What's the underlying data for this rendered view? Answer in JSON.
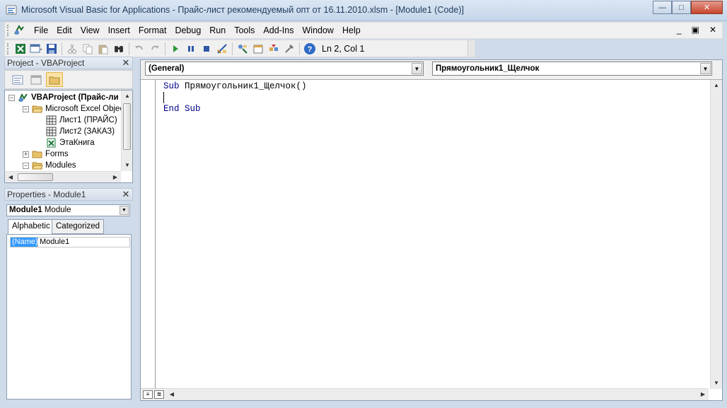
{
  "window": {
    "title": "Microsoft Visual Basic for Applications - Прайс-лист рекомендуемый опт от 16.11.2010.xlsm - [Module1 (Code)]",
    "buttons": {
      "minimize": "—",
      "restore": "□",
      "close": "✕"
    }
  },
  "menu": {
    "items": [
      "File",
      "Edit",
      "View",
      "Insert",
      "Format",
      "Debug",
      "Run",
      "Tools",
      "Add-Ins",
      "Window",
      "Help"
    ],
    "mdi": {
      "minimize": "_",
      "restore": "▣",
      "close": "✕"
    }
  },
  "toolbar": {
    "status": "Ln 2, Col 1",
    "icons": [
      "view-excel-icon",
      "insert-userform-icon",
      "save-icon",
      "cut-icon",
      "copy-icon",
      "paste-icon",
      "find-icon",
      "undo-icon",
      "redo-icon",
      "run-icon",
      "break-icon",
      "reset-icon",
      "design-mode-icon",
      "project-explorer-icon",
      "properties-window-icon",
      "object-browser-icon",
      "toolbox-icon",
      "help-icon"
    ]
  },
  "project_pane": {
    "title": "Project - VBAProject",
    "tree": [
      {
        "label": "VBAProject (Прайс-ли",
        "icon": "vbaproject-icon",
        "bold": true
      },
      {
        "label": "Microsoft Excel Objec",
        "icon": "folder-open-icon"
      },
      {
        "label": "Лист1 (ПРАЙС)",
        "icon": "sheet-icon"
      },
      {
        "label": "Лист2 (ЗАКАЗ)",
        "icon": "sheet-icon"
      },
      {
        "label": "ЭтаКнига",
        "icon": "workbook-icon"
      },
      {
        "label": "Forms",
        "icon": "folder-icon"
      },
      {
        "label": "Modules",
        "icon": "folder-open-icon"
      }
    ]
  },
  "properties_pane": {
    "title": "Properties - Module1",
    "object": {
      "name": "Module1",
      "type": "Module"
    },
    "tabs": [
      "Alphabetic",
      "Categorized"
    ],
    "rows": [
      {
        "name": "(Name)",
        "value": "Module1"
      }
    ]
  },
  "code_window": {
    "object_combo": "(General)",
    "procedure_combo": "Прямоугольник1_Щелчок",
    "lines": [
      {
        "kw": "Sub",
        "rest": " Прямоугольник1_Щелчок()"
      },
      {
        "kw": "",
        "rest": ""
      },
      {
        "kw": "End Sub",
        "rest": ""
      }
    ]
  }
}
